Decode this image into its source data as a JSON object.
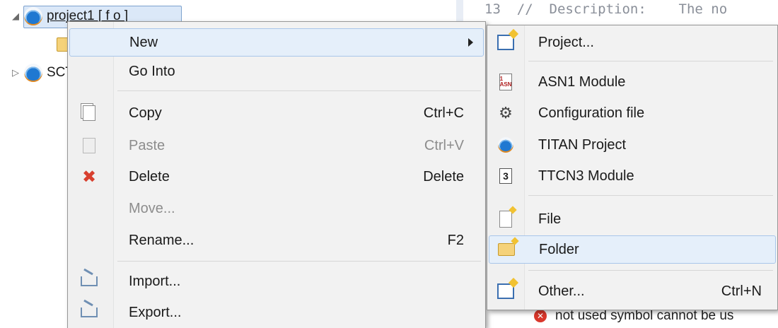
{
  "tree": {
    "project1_label": "project1 [ f  o ]",
    "sct_label": "SCT"
  },
  "editor": {
    "code_line": "13  //  Description:    The no",
    "problem_text": "not used symbol cannot be us"
  },
  "context_menu": {
    "new": "New",
    "go_into": "Go Into",
    "copy": "Copy",
    "copy_shortcut": "Ctrl+C",
    "paste": "Paste",
    "paste_shortcut": "Ctrl+V",
    "delete": "Delete",
    "delete_shortcut": "Delete",
    "move": "Move...",
    "rename": "Rename...",
    "rename_shortcut": "F2",
    "import": "Import...",
    "export": "Export..."
  },
  "new_submenu": {
    "project": "Project...",
    "asn1_module": "ASN1 Module",
    "configuration_file": "Configuration file",
    "titan_project": "TITAN Project",
    "ttcn3_module": "TTCN3 Module",
    "file": "File",
    "folder": "Folder",
    "other": "Other...",
    "other_shortcut": "Ctrl+N"
  },
  "colors": {
    "highlight": "#e5effa",
    "highlight_border": "#a9c6ea",
    "delete_icon": "#d8402f",
    "error_icon": "#d9372b"
  }
}
